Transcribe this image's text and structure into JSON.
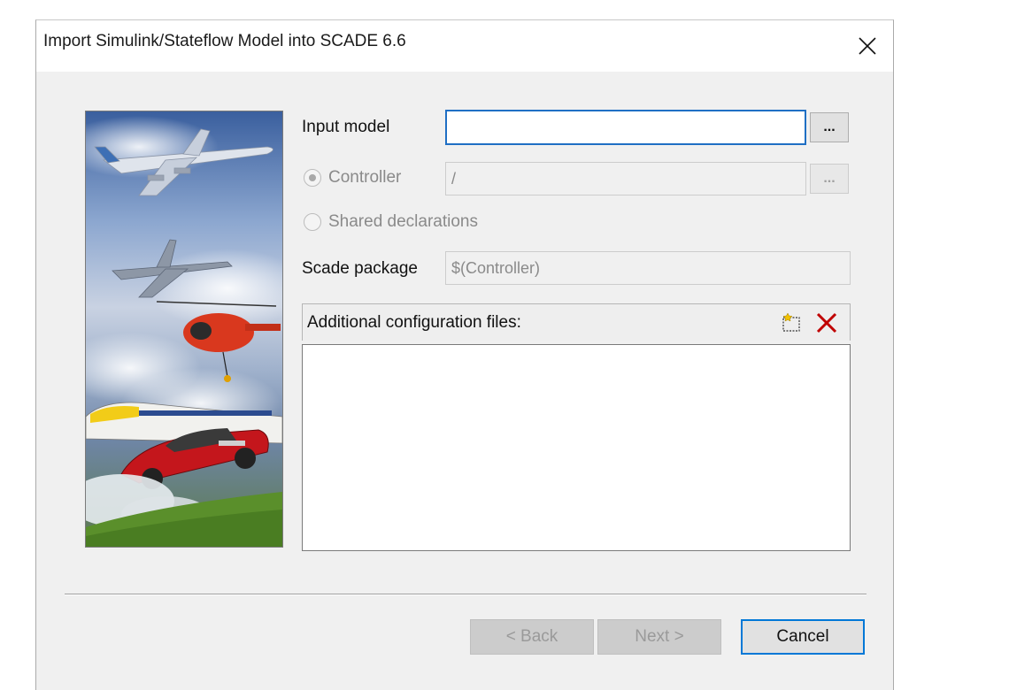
{
  "window": {
    "title": "Import Simulink/Stateflow Model into SCADE 6.6"
  },
  "side_image": {
    "icon": "transport-collage-image"
  },
  "form": {
    "input_model": {
      "label": "Input model",
      "value": "",
      "browse_label": "..."
    },
    "controller": {
      "label": "Controller",
      "value": "/",
      "browse_label": "...",
      "selected": true
    },
    "shared_declarations": {
      "label": "Shared declarations",
      "selected": false
    },
    "scade_package": {
      "label": "Scade package",
      "value": "$(Controller)"
    }
  },
  "config_files": {
    "header": "Additional configuration files:",
    "items": []
  },
  "buttons": {
    "back": "< Back",
    "next": "Next >",
    "cancel": "Cancel"
  },
  "colors": {
    "dialog_bg": "#f0f0f0",
    "focus_blue": "#1f6fc4",
    "default_button_border": "#0078d7",
    "delete_red": "#c00000"
  }
}
